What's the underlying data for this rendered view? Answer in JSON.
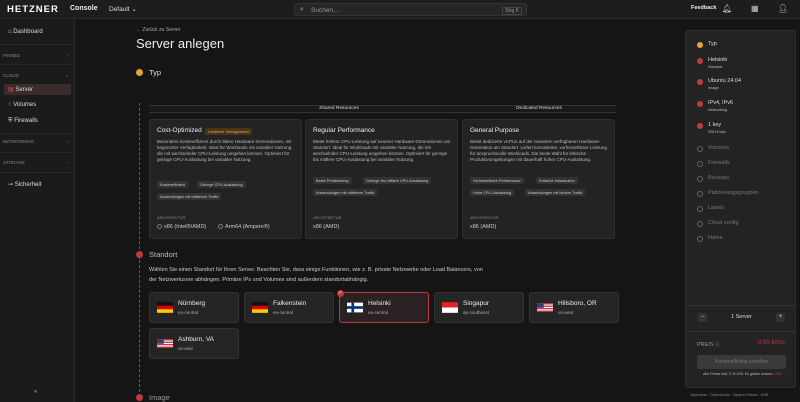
{
  "topbar": {
    "brand": "HETZNER",
    "console": "Console",
    "project": "Default ⌄",
    "search_placeholder": "Suchen...",
    "shortcut": "Strg K",
    "feedback": "Feedback"
  },
  "sidebar": {
    "dashboard": "Dashboard",
    "pinned": "PINNED",
    "cloud": "CLOUD",
    "server": "Server",
    "volumes": "Volumes",
    "firewalls": "Firewalls",
    "networking": "NETWORKING",
    "storage": "STORAGE",
    "security": "Sicherheit",
    "collapse": "«"
  },
  "main": {
    "back": "← Zurück zu Server",
    "title": "Server anlegen",
    "step_type": "Typ",
    "shared": "Shared Resources",
    "dedicated": "Dedicated Resources",
    "cards": [
      {
        "title": "Cost-Optimized",
        "badge": "Limitierte Verfügbarkeit",
        "desc": "Besonders kosteneffizient durch ältere Hardware-Generationen, mit begrenzter Verfügbarkeit. Ideal für Workloads mit variabler Nutzung, die mit wechselnder CPU-Leistung umgehen können. Optimiert für geringe CPU-Auslastung bei variabler Nutzung.",
        "tags": [
          "Kosteneffizient",
          "Geringe CPU-Auslastung",
          "Anwendungen mit mittlerem Traffic"
        ],
        "arch_label": "ARCHITEKTUR",
        "arch": [
          "x86 (Intel®/AMD)",
          "Arm64 (Ampere®)"
        ]
      },
      {
        "title": "Regular Performance",
        "desc": "Bietet höhere CPU-Leistung auf neuerer Hardware-Generationen am Standort. Ideal für Workloads mit variabler Nutzung, die mit wechselnder CPU-Leistung umgehen können. Optimiert für geringe bis mittlere CPU-Auslastung bei variabler Nutzung.",
        "tags": [
          "Beste Preisleistung",
          "Geringe bis mittlere CPU-Auslastung",
          "Anwendungen mit mittlerem Traffic"
        ],
        "arch_label": "ARCHITEKTUR",
        "arch": [
          "x86 (AMD)"
        ]
      },
      {
        "title": "General Purpose",
        "desc": "Bietet dedizierte vCPUs auf der neuesten verfügbaren Hardware-Generation am Standort. Liefert konsistente, vorhersehbare Leistung für anspruchsvolle Workloads. Die beste Wahl für kritische Produktivumgebungen mit dauerhaft hoher CPU-Auslastung.",
        "tags": [
          "Vorhersehbare Performance",
          "Kritische Infrastruktur",
          "Hohe CPU-Auslastung",
          "Anwendungen mit hohem Traffic"
        ],
        "arch_label": "ARCHITEKTUR",
        "arch": [
          "x86 (AMD)"
        ]
      }
    ],
    "step_location": "Standort",
    "loc_desc": "Wählen Sie einen Standort für Ihren Server. Beachten Sie, dass einige Funktionen, wie z. B. private Netzwerke oder Load Balancers, von der Netzwerkzone abhängen. Primäre IPs und Volumes sind außerdem standortabhängig.",
    "locations": [
      {
        "name": "Nürnberg",
        "dc": "eu-central"
      },
      {
        "name": "Falkenstein",
        "dc": "eu-central"
      },
      {
        "name": "Helsinki",
        "dc": "eu-central"
      },
      {
        "name": "Singapur",
        "dc": "ap-southeast"
      },
      {
        "name": "Hillsboro, OR",
        "dc": "us-west"
      },
      {
        "name": "Ashburn, VA",
        "dc": "us-east"
      }
    ],
    "step_image": "Image"
  },
  "summary": {
    "steps": [
      {
        "label": "Typ",
        "sub": ""
      },
      {
        "label": "Helsinki",
        "sub": "Standort"
      },
      {
        "label": "Ubuntu 24.04",
        "sub": "Image"
      },
      {
        "label": "IPv4, IPv6",
        "sub": "Networking"
      },
      {
        "label": "1 key",
        "sub": "SSH-Keys"
      },
      {
        "label": "Volumes"
      },
      {
        "label": "Firewalls"
      },
      {
        "label": "Backups"
      },
      {
        "label": "Platzierungsgruppen"
      },
      {
        "label": "Labels"
      },
      {
        "label": "Cloud config"
      },
      {
        "label": "Name"
      }
    ],
    "count": "1 Server",
    "minus": "−",
    "plus": "+",
    "price_label": "PREIS",
    "price": "0,00 €/mo",
    "cta": "Kostenpflichtig erstellen",
    "note": "Alle Preise inkl. 0 % USt. Es gelten unsere",
    "agb": "AGB"
  },
  "footer": "Impressum · Datenschutz · System Policies · AGB",
  "colors": {
    "accent": "#c0393e",
    "current": "#e6a532"
  }
}
